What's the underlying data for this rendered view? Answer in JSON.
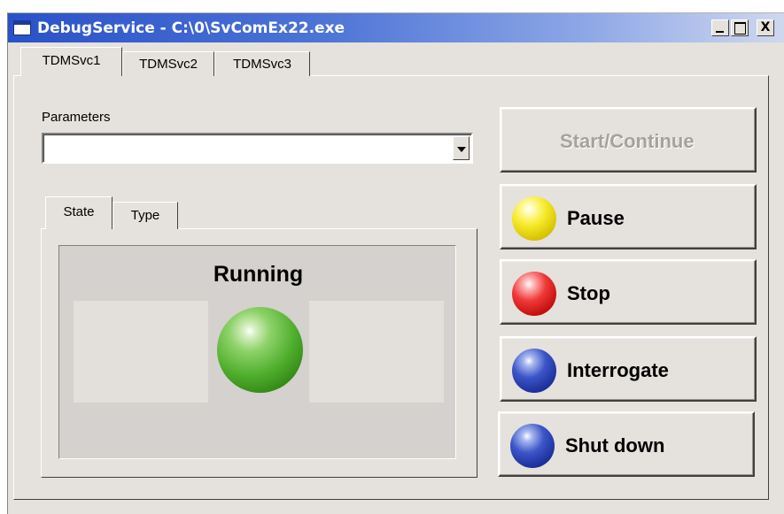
{
  "window": {
    "title": "DebugService - C:\\0\\SvComEx22.exe",
    "controls": {
      "minimize": "_",
      "maximize": "□",
      "close": "X"
    }
  },
  "tabs": [
    {
      "label": "TDMSvc1",
      "selected": true
    },
    {
      "label": "TDMSvc2",
      "selected": false
    },
    {
      "label": "TDMSvc3",
      "selected": false
    }
  ],
  "parameters": {
    "label": "Parameters",
    "value": ""
  },
  "subtabs": [
    {
      "label": "State",
      "selected": true
    },
    {
      "label": "Type",
      "selected": false
    }
  ],
  "status": {
    "text": "Running",
    "indicator_color": "#4fae2c"
  },
  "actions": {
    "start": {
      "label": "Start/Continue",
      "enabled": false
    },
    "pause": {
      "label": "Pause",
      "icon": "yellow-ball-icon",
      "color": "#f6ea2a"
    },
    "stop": {
      "label": "Stop",
      "icon": "red-ball-icon",
      "color": "#f03a3a"
    },
    "interrogate": {
      "label": "Interrogate",
      "icon": "blue-ball-icon",
      "color": "#3b55c8"
    },
    "shutdown": {
      "label": "Shut down",
      "icon": "blue-ball-icon",
      "color": "#3b55c8"
    }
  }
}
